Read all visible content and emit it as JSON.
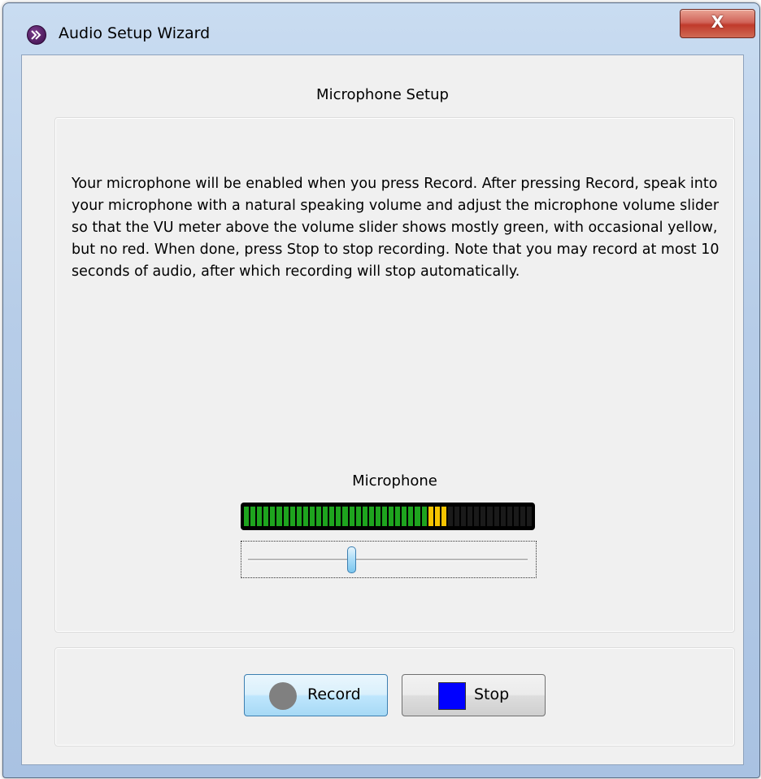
{
  "window": {
    "title": "Audio Setup Wizard",
    "close_symbol": "X"
  },
  "page": {
    "heading": "Microphone Setup",
    "instructions": "Your microphone will be enabled when you press Record. After pressing Record, speak into your microphone with a natural speaking volume and adjust the microphone volume slider so that the VU meter above the volume slider shows mostly green, with occasional yellow, but no red. When done, press Stop to stop recording. Note that you may record at most 10 seconds of audio, after which recording will stop automatically."
  },
  "microphone": {
    "label": "Microphone",
    "vu_meter": {
      "segments_total": 44,
      "green_lit": 28,
      "yellow_lit": 3,
      "colors": {
        "green": "#1ea41e",
        "yellow": "#f5c400",
        "off": "#1a1a1a",
        "background": "#000000"
      }
    },
    "volume_slider": {
      "min": 0,
      "max": 100,
      "value": 37
    }
  },
  "buttons": {
    "record": {
      "label": "Record",
      "icon": "record-circle-icon"
    },
    "stop": {
      "label": "Stop",
      "icon": "stop-square-icon"
    }
  }
}
